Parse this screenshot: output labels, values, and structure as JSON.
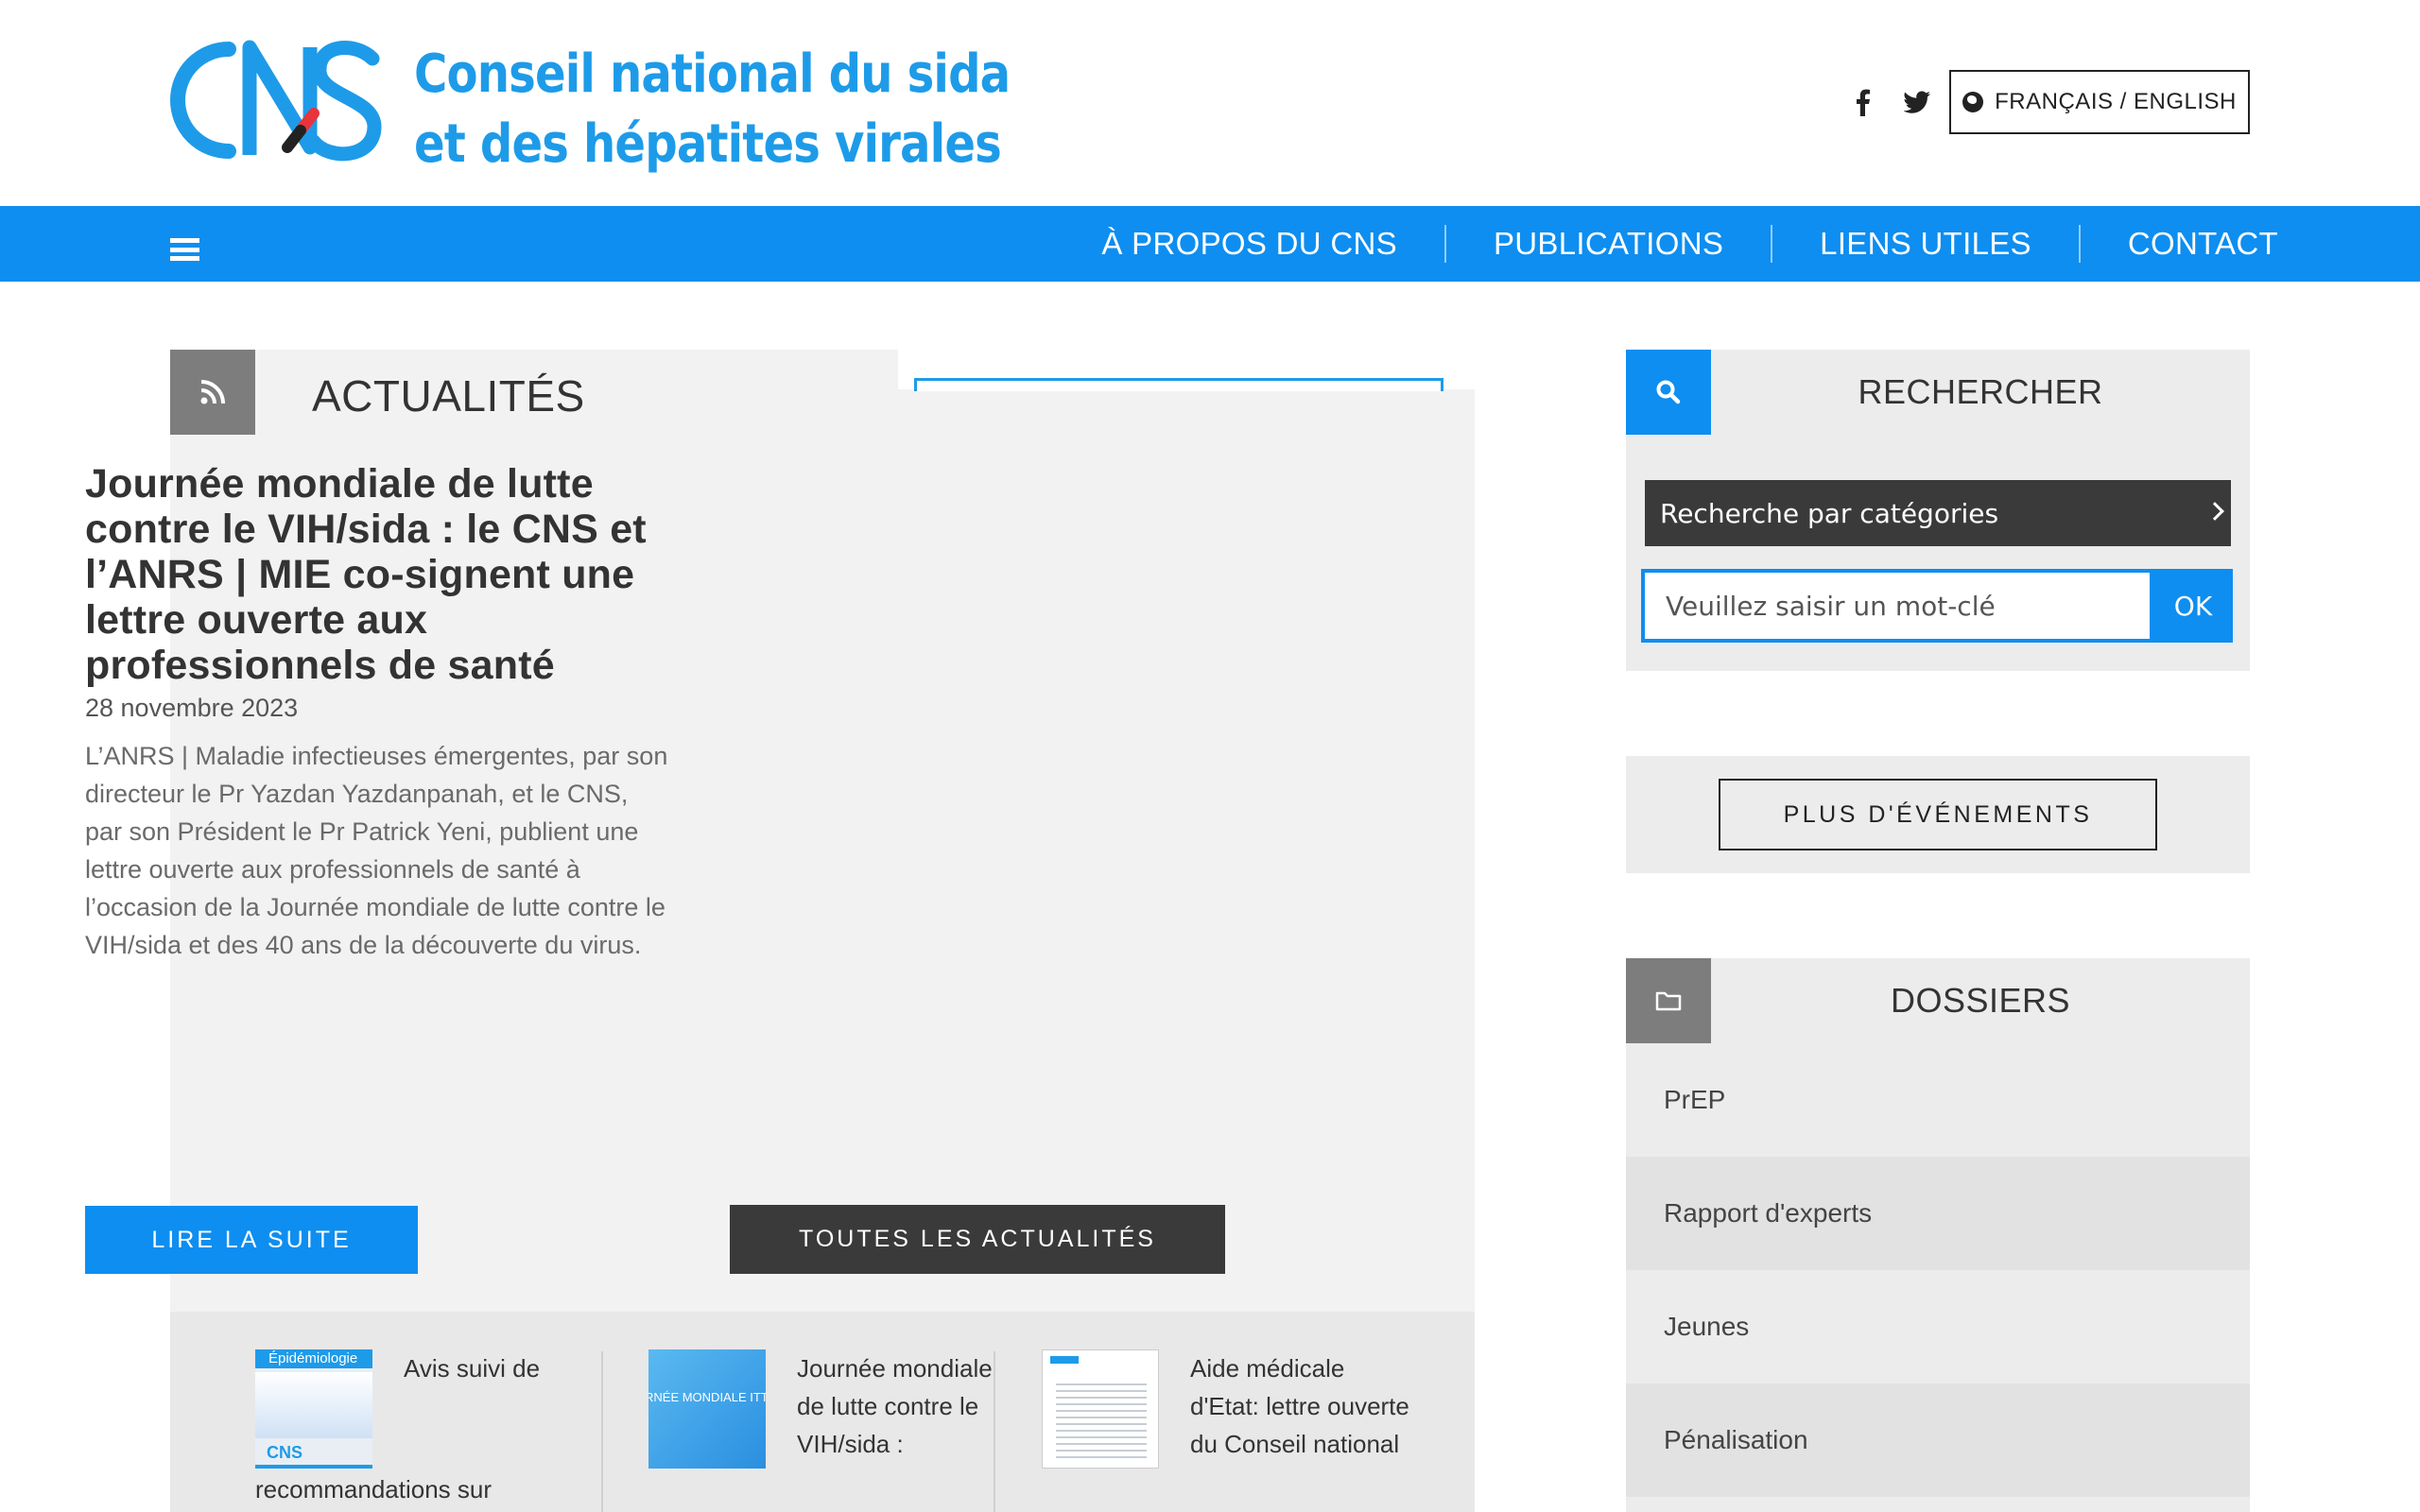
{
  "header": {
    "logo_mark": "CNS",
    "logo_line1": "Conseil national du sida",
    "logo_line2": "et des hépatites virales",
    "social": {
      "facebook": "f",
      "twitter": "twitter-icon"
    },
    "language_button": "FRANÇAIS / ENGLISH"
  },
  "nav": {
    "items": [
      "À PROPOS DU CNS",
      "PUBLICATIONS",
      "LIENS UTILES",
      "CONTACT"
    ]
  },
  "news": {
    "section_title": "ACTUALITÉS",
    "article": {
      "title": "Journée mondiale de lutte contre le VIH/sida : le CNS et l’ANRS | MIE co-signent une lettre ouverte aux professionnels de santé",
      "date": "28 novembre 2023",
      "excerpt": "L’ANRS | Maladie infectieuses émergentes, par son directeur le Pr Yazdan Yazdanpanah, et le CNS, par son Président le Pr Patrick Yeni, publient une lettre ouverte aux professionnels de santé à l’occasion de la Journée mondiale de lutte contre le VIH/sida et des 40 ans de la découverte du virus."
    },
    "read_more": "LIRE LA SUITE",
    "all_news": "TOUTES LES ACTUALITÉS",
    "related": [
      {
        "title": "Avis suivi de",
        "tail": "recommandations sur",
        "thumb_top_text": "Épidémiologie",
        "thumb_logo": "CNS"
      },
      {
        "title": "Journée mondiale de lutte contre le VIH/sida :",
        "tail": "",
        "thumb_text": "RNÉE MONDIALE ITTE CONTRE LE SI"
      },
      {
        "title": "Aide médicale d'Etat: lettre ouverte du Conseil national",
        "tail": ""
      }
    ]
  },
  "sidebar": {
    "search": {
      "heading": "RECHERCHER",
      "category_select": "Recherche par catégories",
      "keyword_placeholder": "Veuillez saisir un mot-clé",
      "ok": "OK"
    },
    "events_button": "PLUS D'ÉVÉNEMENTS",
    "dossiers": {
      "heading": "DOSSIERS",
      "items": [
        "PrEP",
        "Rapport d'experts",
        "Jeunes",
        "Pénalisation"
      ]
    }
  },
  "colors": {
    "brand_blue": "#0e8ef0",
    "logo_blue": "#1e9be8",
    "dark_button": "#3a3a3a",
    "panel_grey": "#f2f2f2",
    "sidebar_grey": "#ececec"
  }
}
